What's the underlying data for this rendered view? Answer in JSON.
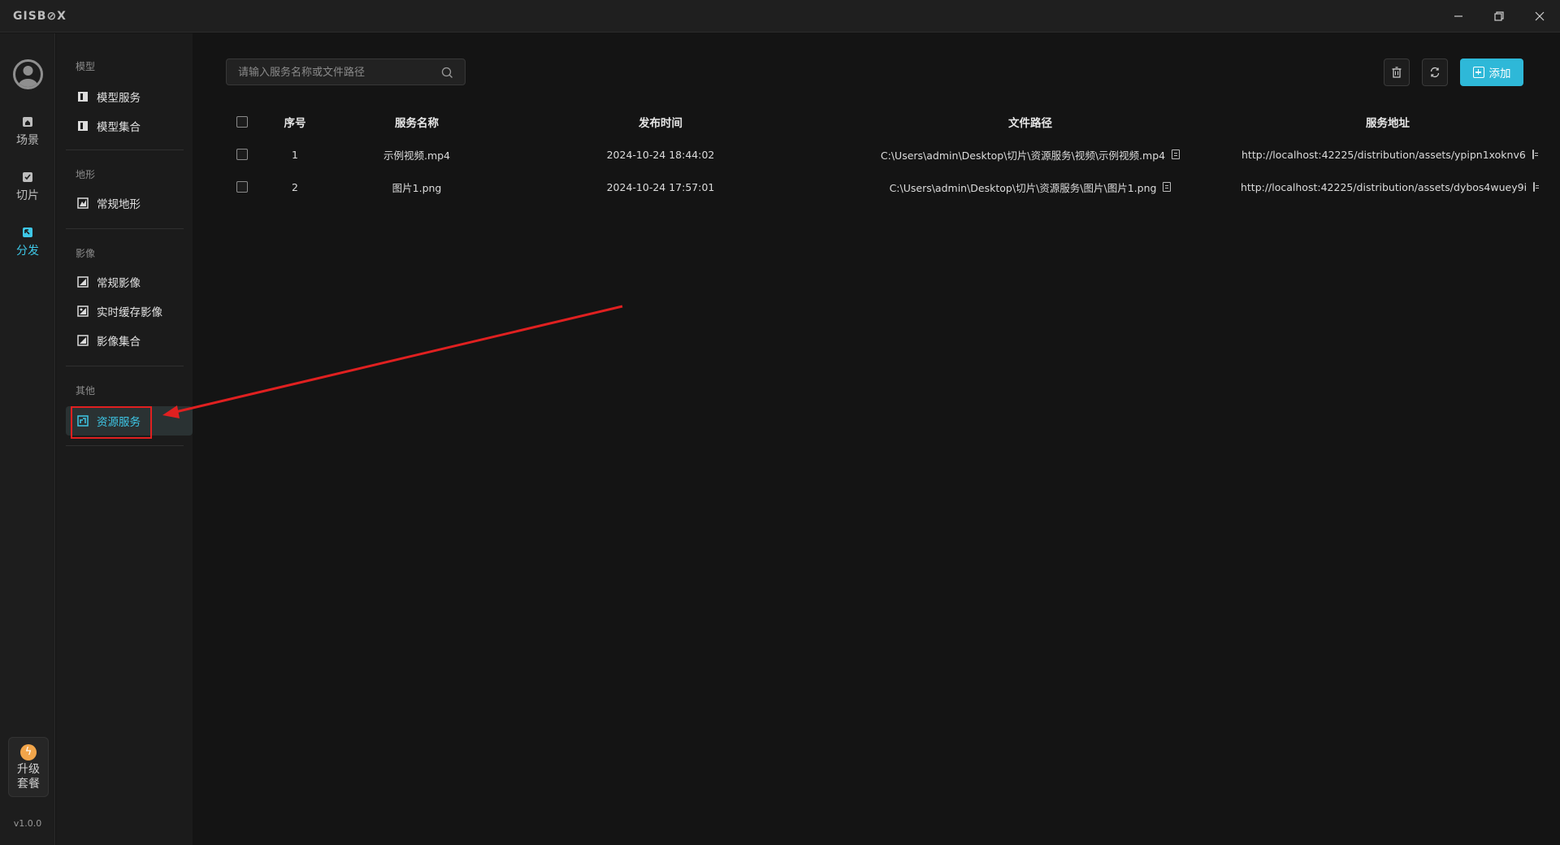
{
  "app": {
    "logo": "GISB⊘X"
  },
  "window_controls": {
    "minimize": "–",
    "restore": "⧉",
    "close": "✕"
  },
  "rail": {
    "items": [
      {
        "label": "场景",
        "icon": "home-icon"
      },
      {
        "label": "切片",
        "icon": "tile-check-icon"
      },
      {
        "label": "分发",
        "icon": "distribute-icon",
        "active": true
      }
    ],
    "upgrade": {
      "line1": "升级",
      "line2": "套餐",
      "icon": "lightning-icon"
    },
    "version": "v1.0.0"
  },
  "subnav": {
    "groups": [
      {
        "title": "模型",
        "items": [
          "模型服务",
          "模型集合"
        ]
      },
      {
        "title": "地形",
        "items": [
          "常规地形"
        ]
      },
      {
        "title": "影像",
        "items": [
          "常规影像",
          "实时缓存影像",
          "影像集合"
        ]
      },
      {
        "title": "其他",
        "items": [
          "资源服务"
        ]
      }
    ],
    "active_item": "资源服务"
  },
  "toolbar": {
    "search_placeholder": "请输入服务名称或文件路径",
    "add_label": "添加"
  },
  "table": {
    "columns": [
      "序号",
      "服务名称",
      "发布时间",
      "文件路径",
      "服务地址"
    ],
    "rows": [
      {
        "index": "1",
        "name": "示例视频.mp4",
        "time": "2024-10-24 18:44:02",
        "path": "C:\\Users\\admin\\Desktop\\切片\\资源服务\\视频\\示例视频.mp4",
        "url": "http://localhost:42225/distribution/assets/ypipn1xoknv6"
      },
      {
        "index": "2",
        "name": "图片1.png",
        "time": "2024-10-24 17:57:01",
        "path": "C:\\Users\\admin\\Desktop\\切片\\资源服务\\图片\\图片1.png",
        "url": "http://localhost:42225/distribution/assets/dybos4wuey9i"
      }
    ]
  },
  "colors": {
    "accent": "#2eb8d8",
    "annotation": "#e02020",
    "upgrade": "#f2a54a"
  }
}
